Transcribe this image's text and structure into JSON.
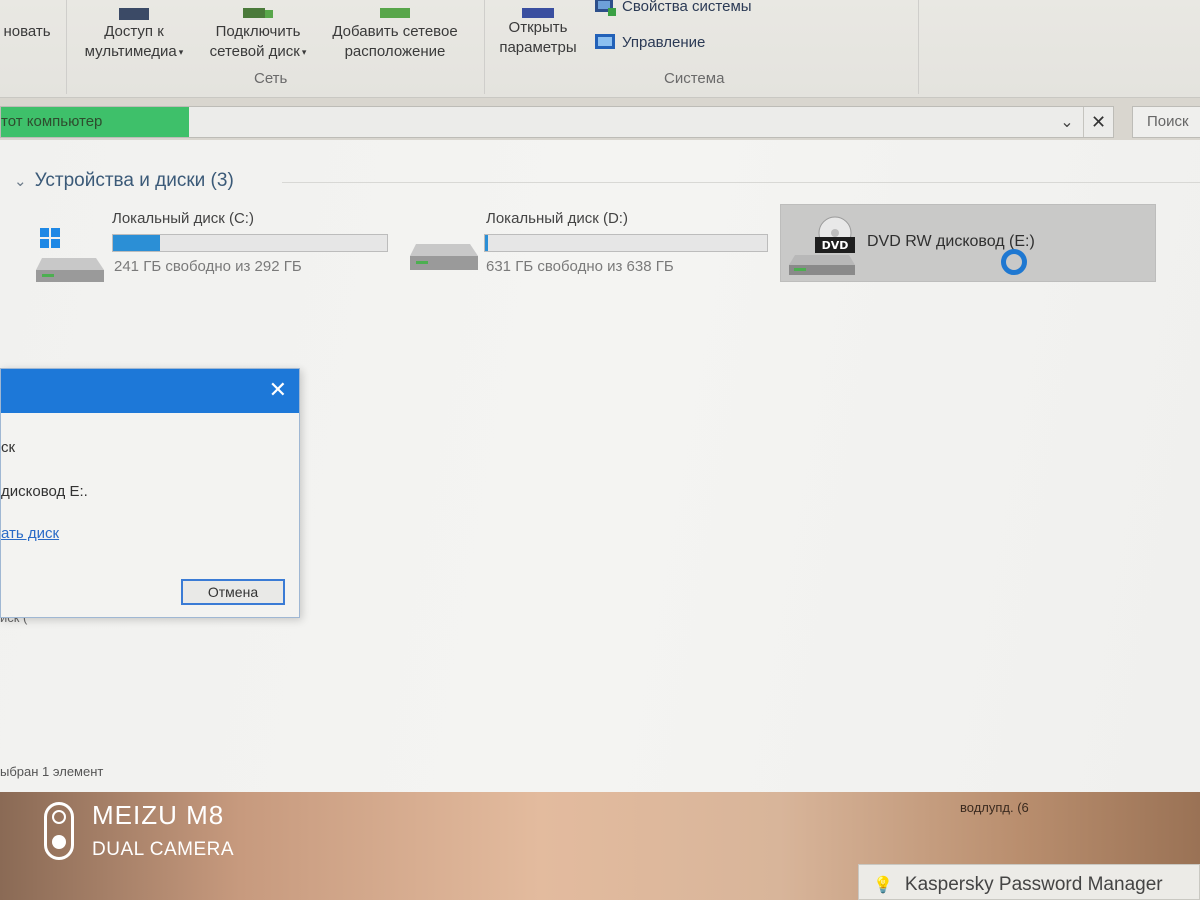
{
  "ribbon": {
    "cut_label": "новать",
    "media_line1": "Доступ к",
    "media_line2": "мультимедиа",
    "map_line1": "Подключить",
    "map_line2": "сетевой диск",
    "addnet_line1": "Добавить сетевое",
    "addnet_line2": "расположение",
    "open_line1": "Открыть",
    "open_line2": "параметры",
    "sysprops_label": "Свойства системы",
    "manage_label": "Управление",
    "group_network": "Сеть",
    "group_system": "Система",
    "dropdown_glyph": "▾"
  },
  "address": {
    "path": "тот компьютер",
    "dropdown_glyph": "⌄",
    "clear_glyph": "✕",
    "progress": 0.17
  },
  "search": {
    "placeholder": "Поиск"
  },
  "group": {
    "chevron": "⌄",
    "title": "Устройства и диски (3)"
  },
  "drives": {
    "c": {
      "name": "Локальный диск (C:)",
      "free": "241 ГБ свободно из 292 ГБ",
      "used_fraction": 0.17
    },
    "d": {
      "name": "Локальный диск (D:)",
      "free": "631 ГБ свободно из 638 ГБ",
      "used_fraction": 0.01
    },
    "e": {
      "name": "DVD RW дисковод (E:)",
      "dvd_badge": "DVD"
    }
  },
  "dialog": {
    "close_glyph": "✕",
    "line1": "ск",
    "line2": "дисковод E:.",
    "link": "ать диск",
    "cancel": "Отмена"
  },
  "partial_label": "иск (",
  "status": {
    "selected": "ыбран 1 элемент"
  },
  "desktop": {
    "tray_text": "водлупд.        (6"
  },
  "kaspersky": {
    "label": "Kaspersky Password Manager",
    "bulb": "💡"
  },
  "watermark": {
    "brand": "MEIZU M8",
    "sub": "DUAL CAMERA"
  },
  "colors": {
    "accent": "#1d78d8",
    "progress": "#3ec06a",
    "drive_fill": "#2b8fd6"
  }
}
